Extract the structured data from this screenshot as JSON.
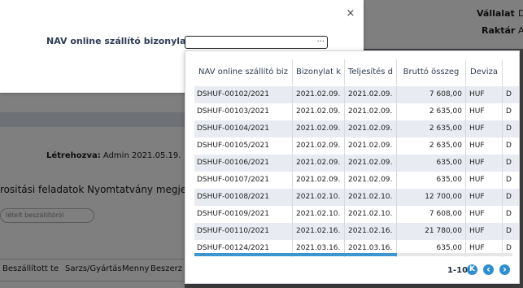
{
  "background": {
    "company_label": "Vállalat",
    "company_value": "D",
    "warehouse_label": "Raktár",
    "warehouse_value": "A",
    "created_by_label": "Létrehozva:",
    "created_by_value": "Admin 2021.05.19.",
    "tab_tasks": "rositási feladatok",
    "tab_print": "Nyomtatvány megjegy",
    "pill_text": "lételt beszállítóról",
    "table_headers": [
      "Beszállított te",
      "Sarzs/Gyártás",
      "Menny",
      "Beszerz"
    ]
  },
  "dialog": {
    "close_icon": "×",
    "field_label": "NAV online szállító bizonylatszám",
    "field_value": "",
    "field_dots": "..."
  },
  "grid": {
    "columns": [
      "NAV online szállító biz",
      "Bizonylat k",
      "Teljesítés d",
      "Bruttó összeg",
      "Deviza",
      ""
    ],
    "rows": [
      [
        "DSHUF-00102/2021",
        "2021.02.09.",
        "2021.02.09.",
        "7 608,00",
        "HUF",
        "D"
      ],
      [
        "DSHUF-00103/2021",
        "2021.02.09.",
        "2021.02.09.",
        "2 635,00",
        "HUF",
        "D"
      ],
      [
        "DSHUF-00104/2021",
        "2021.02.09.",
        "2021.02.09.",
        "2 635,00",
        "HUF",
        "D"
      ],
      [
        "DSHUF-00105/2021",
        "2021.02.09.",
        "2021.02.09.",
        "2 635,00",
        "HUF",
        "D"
      ],
      [
        "DSHUF-00106/2021",
        "2021.02.09.",
        "2021.02.09.",
        "635,00",
        "HUF",
        "D"
      ],
      [
        "DSHUF-00107/2021",
        "2021.02.09.",
        "2021.02.09.",
        "635,00",
        "HUF",
        "D"
      ],
      [
        "DSHUF-00108/2021",
        "2021.02.10.",
        "2021.02.10.",
        "12 700,00",
        "HUF",
        "D"
      ],
      [
        "DSHUF-00109/2021",
        "2021.02.10.",
        "2021.02.10.",
        "7 608,00",
        "HUF",
        "D"
      ],
      [
        "DSHUF-00110/2021",
        "2021.02.16.",
        "2021.02.16.",
        "21 780,00",
        "HUF",
        "D"
      ],
      [
        "DSHUF-00124/2021",
        "2021.03.16.",
        "2021.03.16.",
        "635,00",
        "HUF",
        "D"
      ]
    ],
    "pager_text": "1-10",
    "first_icon": "K",
    "prev_icon": "‹",
    "next_icon": "›",
    "accent_color": "#2f8ed0"
  }
}
